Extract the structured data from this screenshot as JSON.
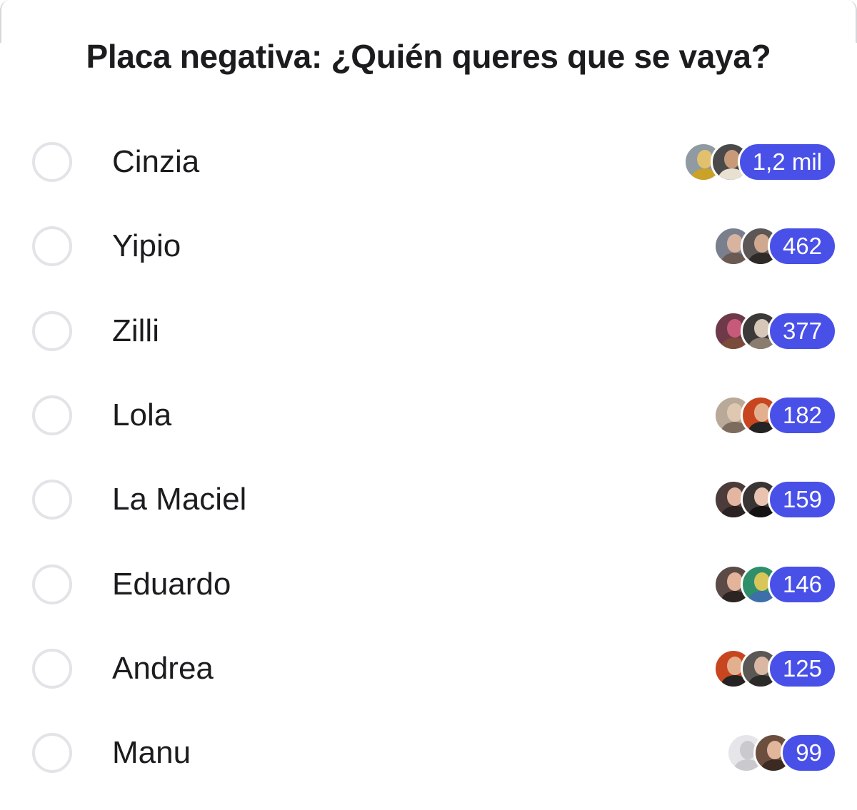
{
  "poll": {
    "title": "Placa negativa: ¿Quién queres que se vaya?",
    "accent_color": "#4950e8",
    "options": [
      {
        "label": "Cinzia",
        "count": "1,2 mil",
        "avatars": [
          {
            "bg": "#8f9aa3",
            "face": "#e1c16e",
            "body": "#c9a227"
          },
          {
            "bg": "#4a4a4a",
            "face": "#c89a7a",
            "body": "#e8e1d2"
          }
        ]
      },
      {
        "label": "Yipio",
        "count": "462",
        "avatars": [
          {
            "bg": "#7a7f8e",
            "face": "#d7b3a0",
            "body": "#6b5a52"
          },
          {
            "bg": "#5c5656",
            "face": "#cfa88f",
            "body": "#2f2a28"
          }
        ]
      },
      {
        "label": "Zilli",
        "count": "377",
        "avatars": [
          {
            "bg": "#6e3a4a",
            "face": "#c75a7a",
            "body": "#7a4b3a"
          },
          {
            "bg": "#3c3a38",
            "face": "#d6c7b8",
            "body": "#8a7d70"
          }
        ]
      },
      {
        "label": "Lola",
        "count": "182",
        "avatars": [
          {
            "bg": "#b9a999",
            "face": "#e0c8b0",
            "body": "#7d6b5d"
          },
          {
            "bg": "#c8461f",
            "face": "#e2b08f",
            "body": "#232323"
          }
        ]
      },
      {
        "label": "La Maciel",
        "count": "159",
        "avatars": [
          {
            "bg": "#4b3b3a",
            "face": "#e4b5a0",
            "body": "#2b2222"
          },
          {
            "bg": "#3a3535",
            "face": "#e8c3b0",
            "body": "#141212"
          }
        ]
      },
      {
        "label": "Eduardo",
        "count": "146",
        "avatars": [
          {
            "bg": "#5b4a46",
            "face": "#e3b39a",
            "body": "#2c2423"
          },
          {
            "bg": "#2e8f6a",
            "face": "#d9c65a",
            "body": "#3d6fa8"
          }
        ]
      },
      {
        "label": "Andrea",
        "count": "125",
        "avatars": [
          {
            "bg": "#c8461f",
            "face": "#e2b08f",
            "body": "#232323"
          },
          {
            "bg": "#5a5754",
            "face": "#d9b7a3",
            "body": "#2c2a29"
          }
        ]
      },
      {
        "label": "Manu",
        "count": "99",
        "avatars": [
          {
            "bg": "#e6e6ea",
            "face": "#c9c9ce",
            "body": "#c9c9ce"
          },
          {
            "bg": "#6b4e3e",
            "face": "#e2b69b",
            "body": "#3a2a22"
          }
        ]
      }
    ]
  }
}
